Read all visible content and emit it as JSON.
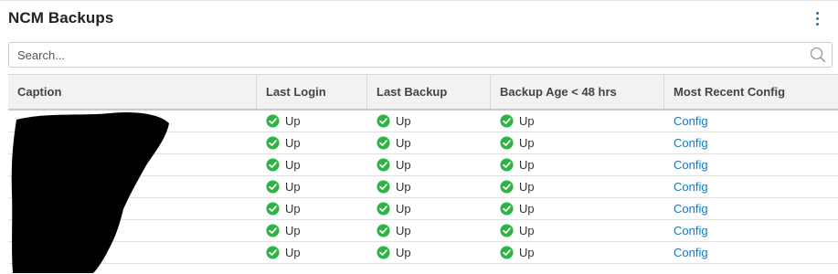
{
  "widget": {
    "title": "NCM Backups"
  },
  "search": {
    "placeholder": "Search..."
  },
  "table": {
    "columns": [
      "Caption",
      "Last Login",
      "Last Backup",
      "Backup Age < 48 hrs",
      "Most Recent Config"
    ],
    "rows": [
      {
        "caption": "",
        "last_login": "Up",
        "last_backup": "Up",
        "backup_age": "Up",
        "config": "Config"
      },
      {
        "caption": "",
        "last_login": "Up",
        "last_backup": "Up",
        "backup_age": "Up",
        "config": "Config"
      },
      {
        "caption": "",
        "last_login": "Up",
        "last_backup": "Up",
        "backup_age": "Up",
        "config": "Config"
      },
      {
        "caption": "",
        "last_login": "Up",
        "last_backup": "Up",
        "backup_age": "Up",
        "config": "Config"
      },
      {
        "caption": "",
        "last_login": "Up",
        "last_backup": "Up",
        "backup_age": "Up",
        "config": "Config"
      },
      {
        "caption": "",
        "last_login": "Up",
        "last_backup": "Up",
        "backup_age": "Up",
        "config": "Config"
      },
      {
        "caption": "",
        "last_login": "Up",
        "last_backup": "Up",
        "backup_age": "Up",
        "config": "Config"
      }
    ]
  },
  "icons": {
    "status_ok": "check-circle-icon",
    "menu": "kebab-menu-icon",
    "search": "search-icon"
  },
  "colors": {
    "status_ok": "#2fb344",
    "link": "#1a7ab8",
    "menu": "#1b73b8",
    "header_bg": "#f2f2f2"
  }
}
